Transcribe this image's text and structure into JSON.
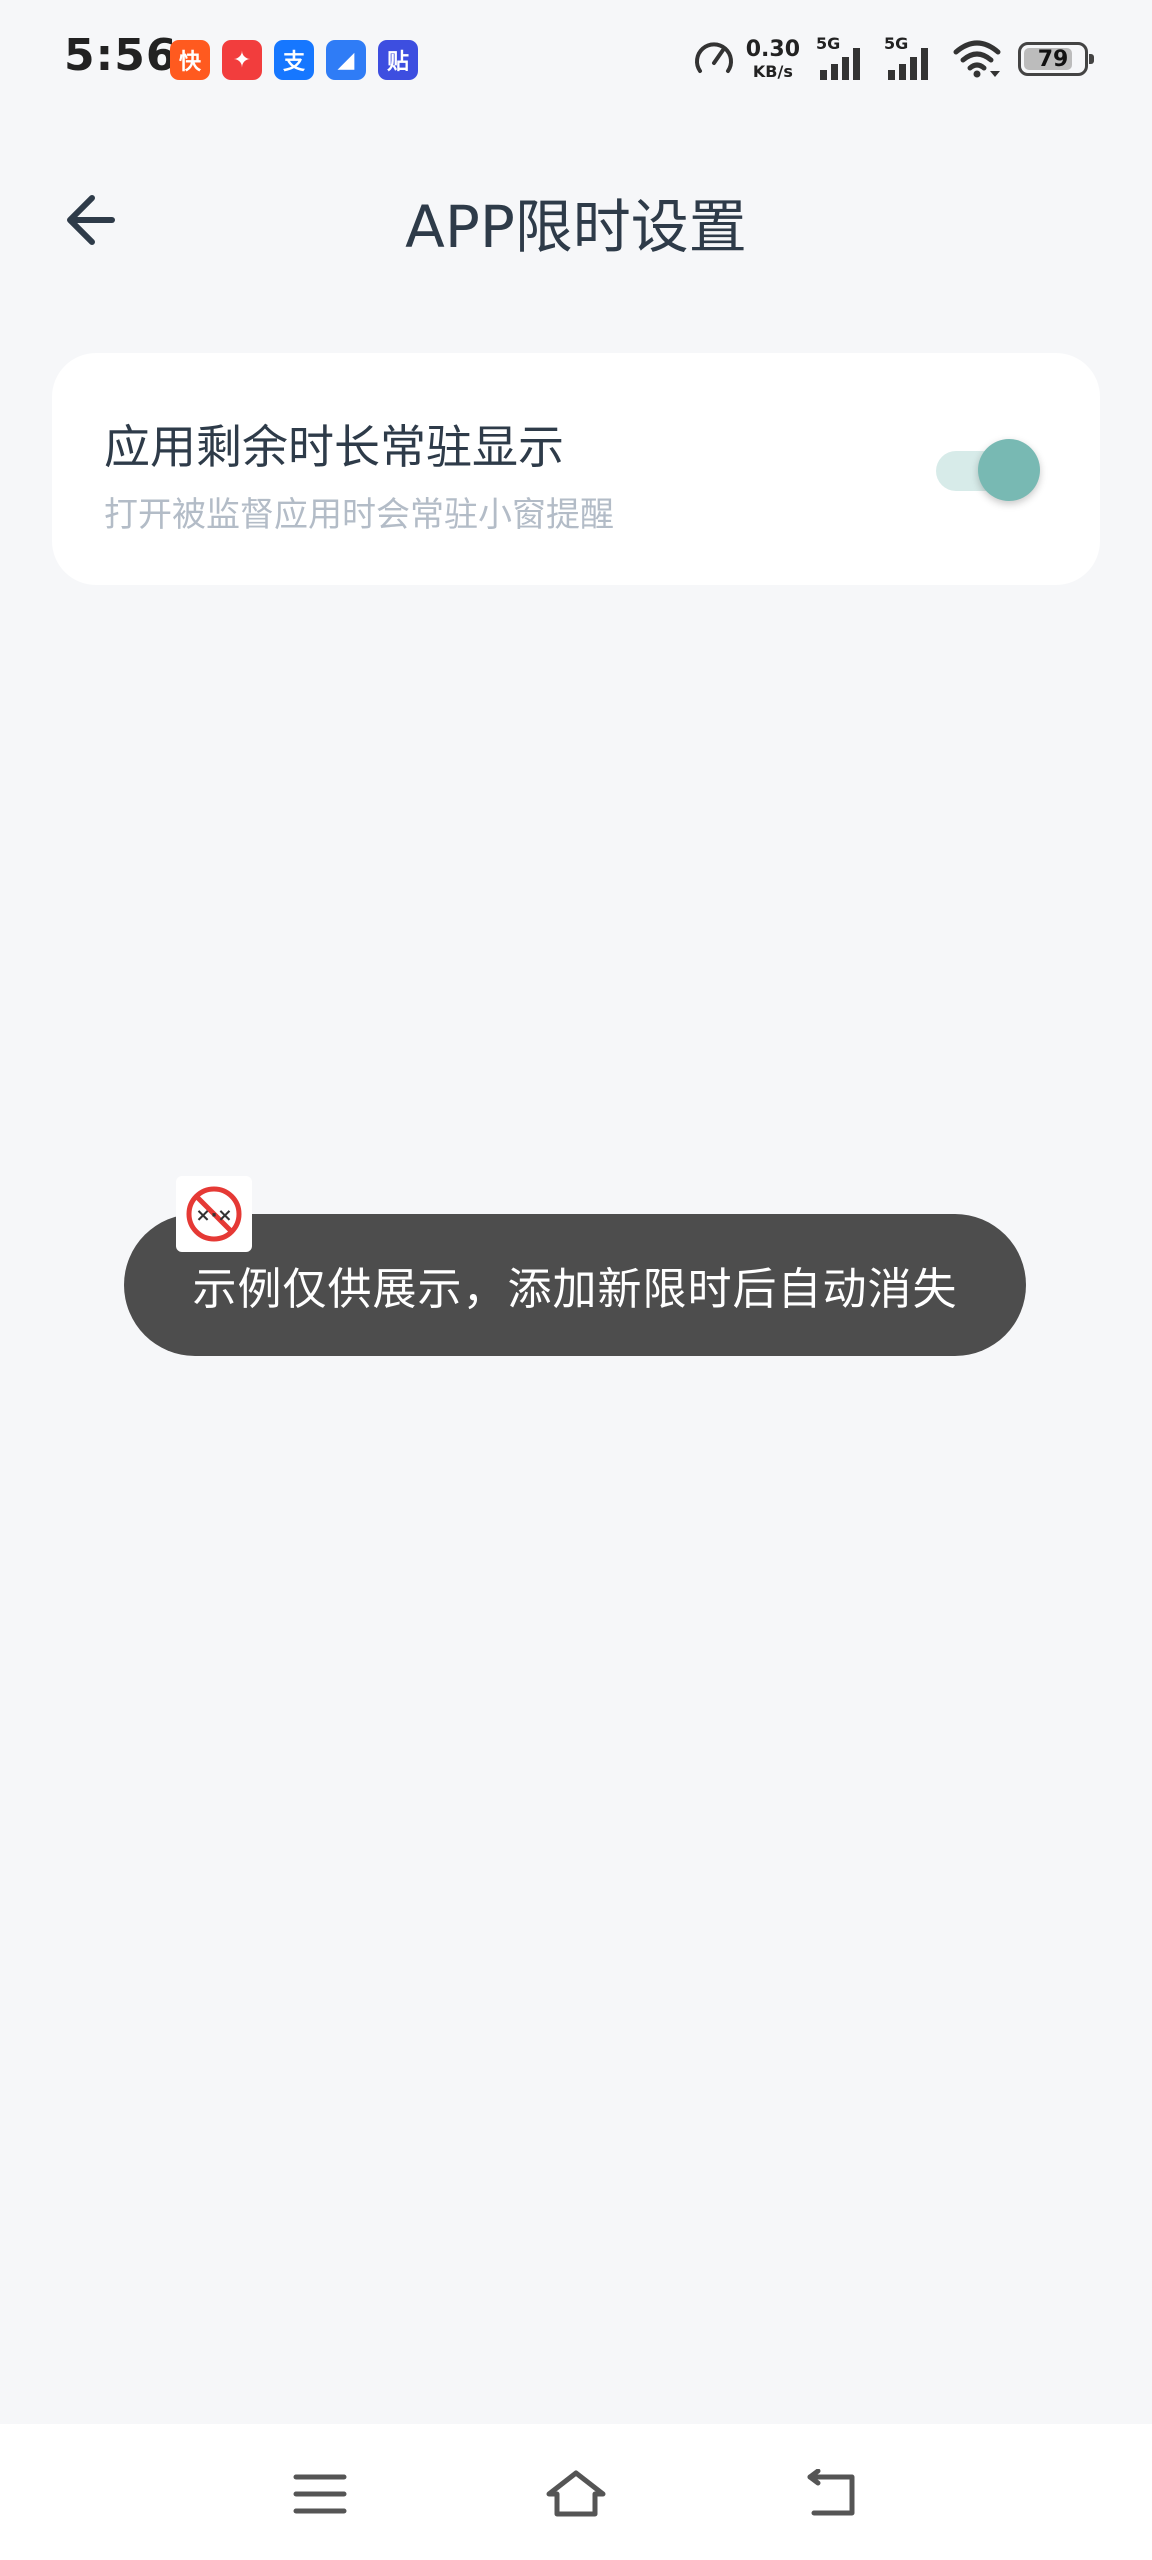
{
  "status_bar": {
    "time": "5:56",
    "notifications": [
      {
        "icon": "kuaishou-icon",
        "glyph": "快",
        "color": "#ff5a1f"
      },
      {
        "icon": "game-app-icon",
        "glyph": "✦",
        "color": "#f23d3d"
      },
      {
        "icon": "alipay-icon",
        "glyph": "支",
        "color": "#1677ff"
      },
      {
        "icon": "browser-app-icon",
        "glyph": "◢",
        "color": "#2f7cf6"
      },
      {
        "icon": "tieba-icon",
        "glyph": "贴",
        "color": "#3d4ee0"
      }
    ],
    "speed_value": "0.30",
    "speed_unit": "KB/s",
    "signal_1_label": "5G",
    "signal_2_label": "5G",
    "battery_level": "79"
  },
  "header": {
    "title": "APP限时设置"
  },
  "setting": {
    "title": "应用剩余时长常驻显示",
    "subtitle": "打开被监督应用时会常驻小窗提醒",
    "enabled": true
  },
  "toast": {
    "message": "示例仅供展示，添加新限时后自动消失",
    "icon": "prohibited-icon"
  },
  "colors": {
    "accent": "#78b9b3",
    "toggle_track": "#d7ebe9",
    "background": "#f6f7f9",
    "toast_background": "#4d4d4d"
  }
}
